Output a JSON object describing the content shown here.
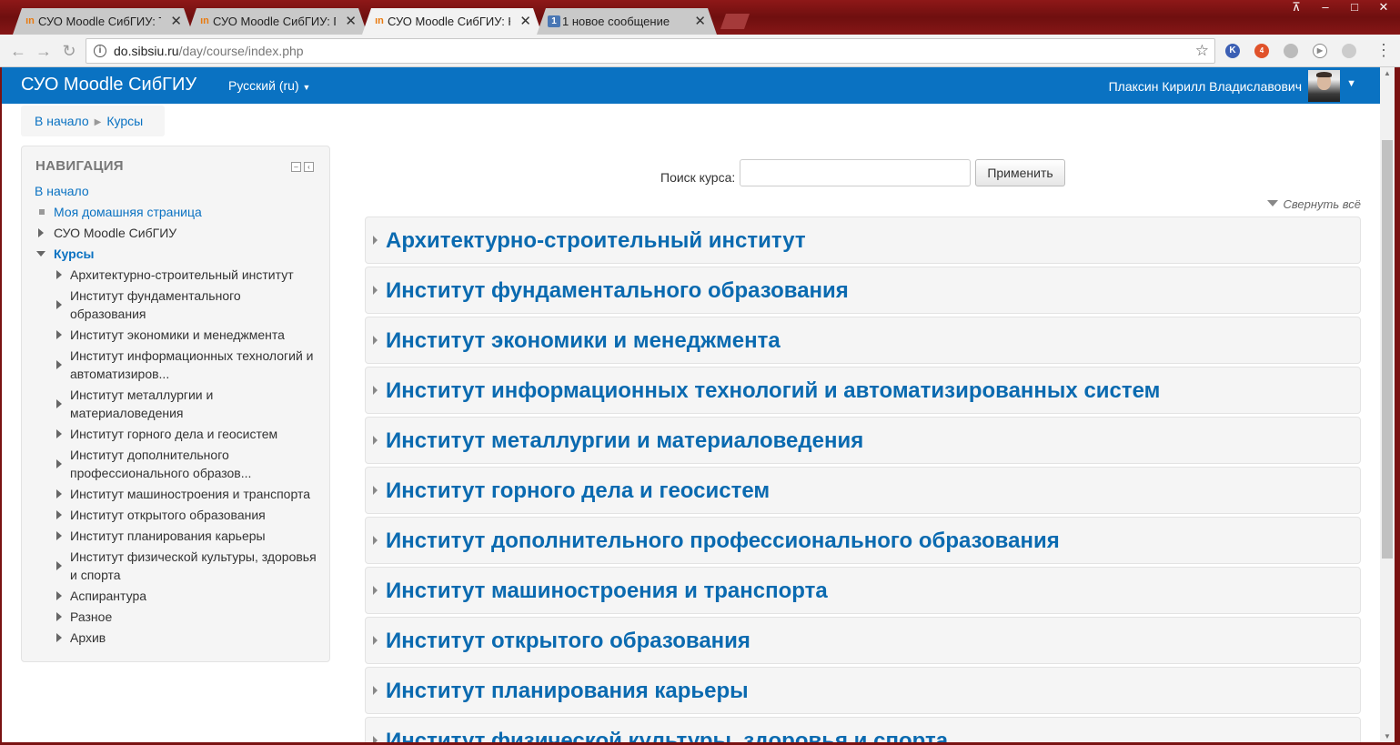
{
  "browser": {
    "tabs": [
      {
        "title": "СУО Moodle СибГИУ: Те",
        "favicon": "moodle-icon",
        "active": false
      },
      {
        "title": "СУО Moodle СибГИУ: Пс",
        "favicon": "moodle-icon",
        "active": false
      },
      {
        "title": "СУО Moodle СибГИУ: Ка",
        "favicon": "moodle-icon",
        "active": true
      },
      {
        "title": "1 новое сообщение",
        "favicon": "message-icon",
        "badge": "1",
        "active": false
      }
    ],
    "url_host": "do.sibsiu.ru",
    "url_path": "/day/course/index.php",
    "extension_badge": "4"
  },
  "navbar": {
    "brand": "СУО Moodle СибГИУ",
    "language": "Русский (ru)",
    "user_name": "Плаксин Кирилл Владиславович"
  },
  "breadcrumb": {
    "items": [
      "В начало",
      "Курсы"
    ]
  },
  "navigation_block": {
    "title": "НАВИГАЦИЯ",
    "home": "В начало",
    "my_home": "Моя домашняя страница",
    "site": "СУО Moodle СибГИУ",
    "courses": "Курсы",
    "course_items": [
      "Архитектурно-строительный институт",
      "Институт фундаментального образования",
      "Институт экономики и менеджмента",
      "Институт информационных технологий и автоматизиров...",
      "Институт металлургии и материаловедения",
      "Институт горного дела и геосистем",
      "Институт дополнительного профессионального образов...",
      "Институт машиностроения и транспорта",
      "Институт открытого образования",
      "Институт планирования карьеры",
      "Институт физической культуры, здоровья и спорта",
      "Аспирантура",
      "Разное",
      "Архив"
    ]
  },
  "search": {
    "label": "Поиск курса:",
    "value": "",
    "button": "Применить"
  },
  "collapse_all": "Свернуть всё",
  "categories": [
    "Архитектурно-строительный институт",
    "Институт фундаментального образования",
    "Институт экономики и менеджмента",
    "Институт информационных технологий и автоматизированных систем",
    "Институт металлургии и материаловедения",
    "Институт горного дела и геосистем",
    "Институт дополнительного профессионального образования",
    "Институт машиностроения и транспорта",
    "Институт открытого образования",
    "Институт планирования карьеры",
    "Институт физической культуры, здоровья и спорта"
  ],
  "colors": {
    "navbar": "#0a72c2",
    "link": "#0a72c2",
    "frame": "#7a1212"
  }
}
